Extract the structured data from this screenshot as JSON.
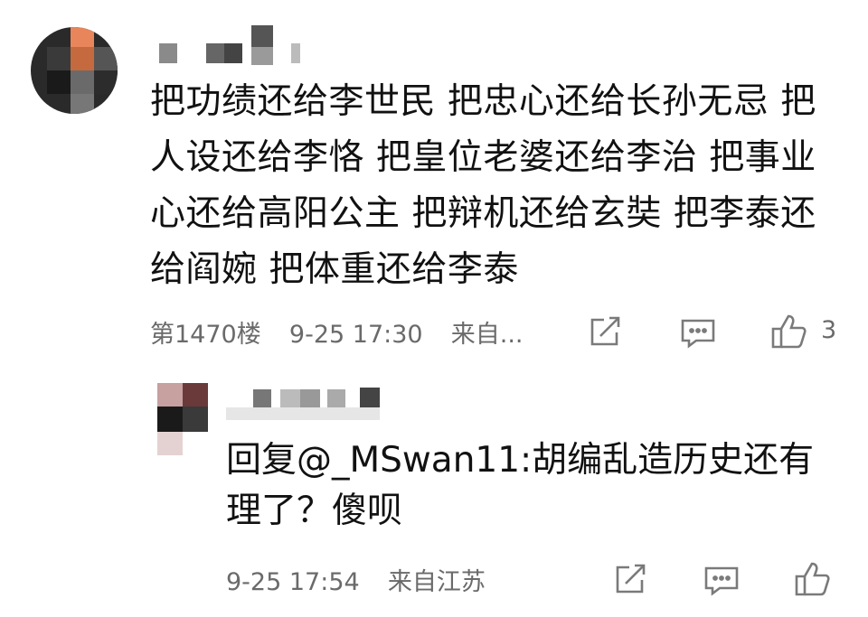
{
  "comment": {
    "text": "把功绩还给李世民 把忠心还给长孙无忌 把人设还给李恪 把皇位老婆还给李治 把事业心还给高阳公主 把辩机还给玄奘 把李泰还给阎婉 把体重还给李泰",
    "floor": "第1470楼",
    "time": "9-25 17:30",
    "source": "来自...",
    "like_count": "3"
  },
  "reply": {
    "text": "回复@_MSwan11:胡编乱造历史还有理了？傻呗",
    "time": "9-25 17:54",
    "source": "来自江苏"
  },
  "icons": {
    "share": "share-icon",
    "comment": "comment-icon",
    "like": "thumbs-up-icon"
  },
  "colors": {
    "text": "#111111",
    "meta": "#6a6a6a",
    "icon": "#7a7a7a"
  }
}
